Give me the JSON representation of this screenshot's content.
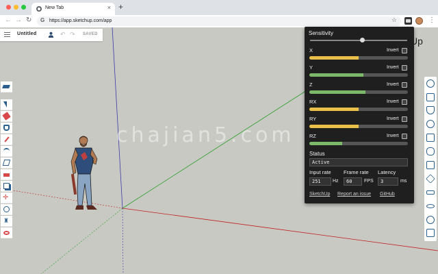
{
  "browser": {
    "tab_title": "New Tab",
    "url": "https://app.sketchup.com/app",
    "new_tab": "+",
    "tab_close": "×",
    "back": "←",
    "forward": "→",
    "reload": "↻",
    "bookmark": "☆",
    "menu": "⋮",
    "omnibox_icon": "G",
    "traffic_lights": [
      "#ff5f57",
      "#febc2e",
      "#28c840"
    ]
  },
  "app": {
    "document_title": "Untitled",
    "save_status": "SAVED",
    "brand_fragment": "Up",
    "undo": "↶",
    "redo": "↷",
    "watermark": "chajian5.com",
    "left_tools": [
      "select-icon",
      "eraser-icon",
      "paint-bucket-icon",
      "pencil-icon",
      "arc-icon",
      "rectangle-icon",
      "push-pull-icon",
      "offset-icon",
      "move-icon",
      "rotate-icon",
      "walk-icon",
      "orbit-icon"
    ],
    "right_tools": [
      "entity-info-icon",
      "components-icon",
      "materials-icon",
      "styles-icon",
      "layers-icon",
      "outliner-icon",
      "scenes-icon",
      "solid-tools-icon",
      "measurements-icon",
      "display-icon",
      "instructor-icon",
      "warehouse-icon"
    ]
  },
  "popup": {
    "sensitivity_label": "Sensitivity",
    "sensitivity_value": 0.54,
    "invert_label": "Invert",
    "axes": [
      {
        "name": "X",
        "level": 0.5,
        "color": "#e8c04a"
      },
      {
        "name": "Y",
        "level": 0.55,
        "color": "#7cb86a"
      },
      {
        "name": "Z",
        "level": 0.57,
        "color": "#7cb86a"
      },
      {
        "name": "RX",
        "level": 0.5,
        "color": "#e8c04a"
      },
      {
        "name": "RY",
        "level": 0.5,
        "color": "#e8c04a"
      },
      {
        "name": "RZ",
        "level": 0.33,
        "color": "#7cb86a"
      }
    ],
    "status_label": "Status",
    "status_value": "Active",
    "input_rate_label": "Input rate",
    "input_rate_value": "251",
    "input_rate_unit": "Hz",
    "frame_rate_label": "Frame rate",
    "frame_rate_value": "60",
    "frame_rate_unit": "FPS",
    "latency_label": "Latency",
    "latency_value": "3",
    "latency_unit": "ms",
    "links": [
      "SketchUp",
      "Report an issue",
      "GitHub"
    ]
  }
}
